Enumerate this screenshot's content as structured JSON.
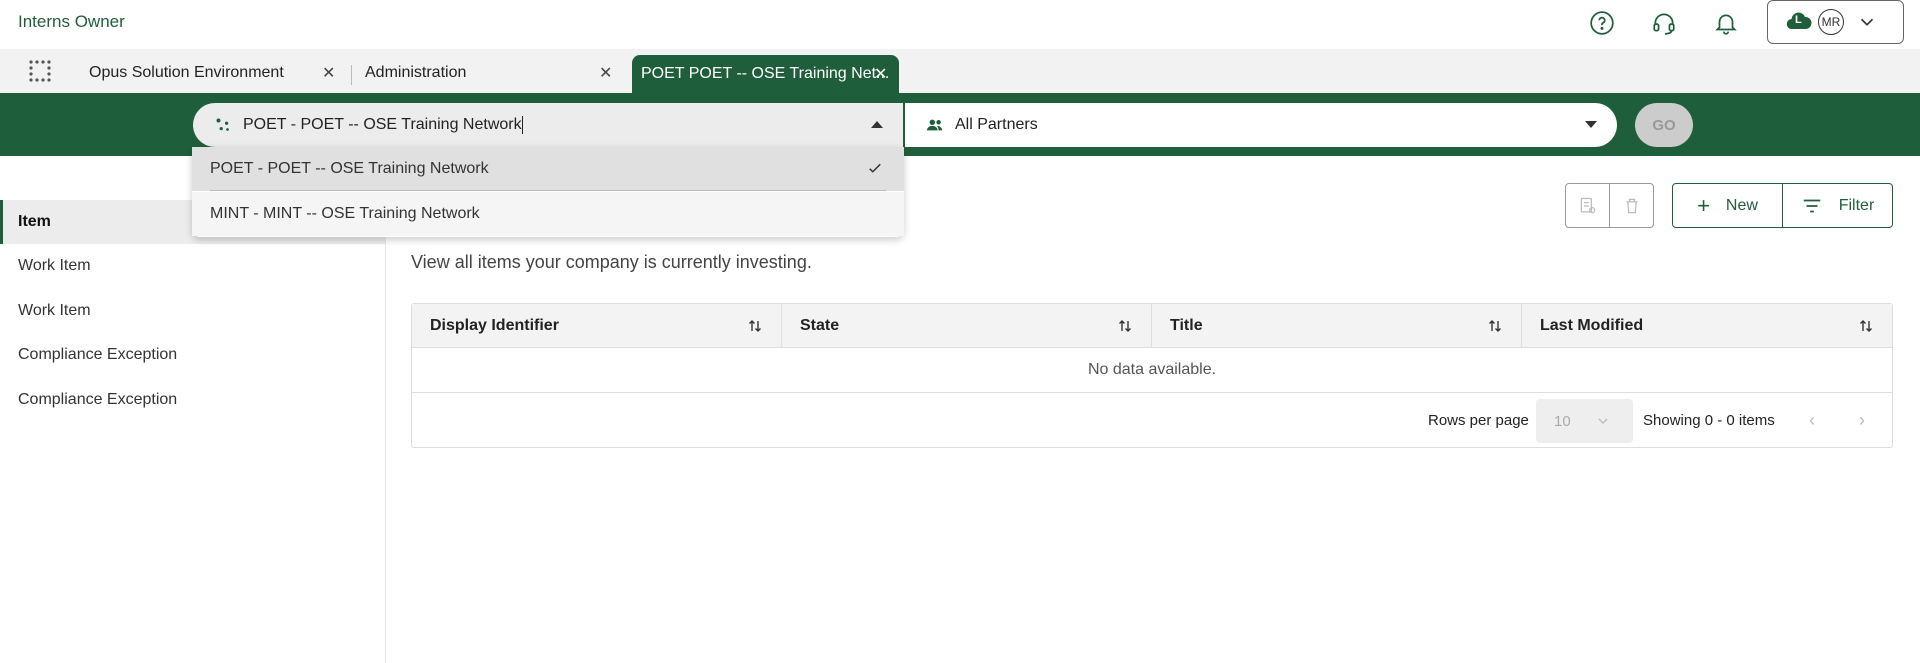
{
  "app": {
    "title": "Interns Owner"
  },
  "header": {
    "icons": [
      "help-icon",
      "support-headset-icon",
      "notification-bell-icon"
    ],
    "user": {
      "initials": "MR",
      "cloud_letter": "L"
    }
  },
  "tabs": [
    {
      "label": "Opus Solution Environment"
    },
    {
      "label": "Administration"
    },
    {
      "label": "POET POET -- OSE Training Net..."
    }
  ],
  "network_selector": {
    "value": "POET - POET -- OSE Training Network",
    "options": [
      {
        "label": "POET - POET -- OSE Training Network",
        "selected": true
      },
      {
        "label": "MINT - MINT -- OSE Training Network",
        "selected": false
      }
    ]
  },
  "partner_selector": {
    "value": "All Partners"
  },
  "go_button": {
    "label": "GO"
  },
  "sidebar": {
    "items": [
      {
        "label": "Item",
        "active": true
      },
      {
        "label": "Work Item"
      },
      {
        "label": "Work Item"
      },
      {
        "label": "Compliance Exception"
      },
      {
        "label": "Compliance Exception"
      }
    ]
  },
  "toolbar": {
    "new_label": "New",
    "filter_label": "Filter"
  },
  "main": {
    "description": "View all items your company is currently investing."
  },
  "table": {
    "columns": [
      "Display Identifier",
      "State",
      "Title",
      "Last Modified"
    ],
    "empty_text": "No data available.",
    "rows_per_page_label": "Rows per page",
    "rows_per_page_value": "10",
    "showing_text": "Showing 0 - 0 items"
  },
  "colors": {
    "brand": "#1f5e3b",
    "tab_bg": "#f2f2f2"
  }
}
